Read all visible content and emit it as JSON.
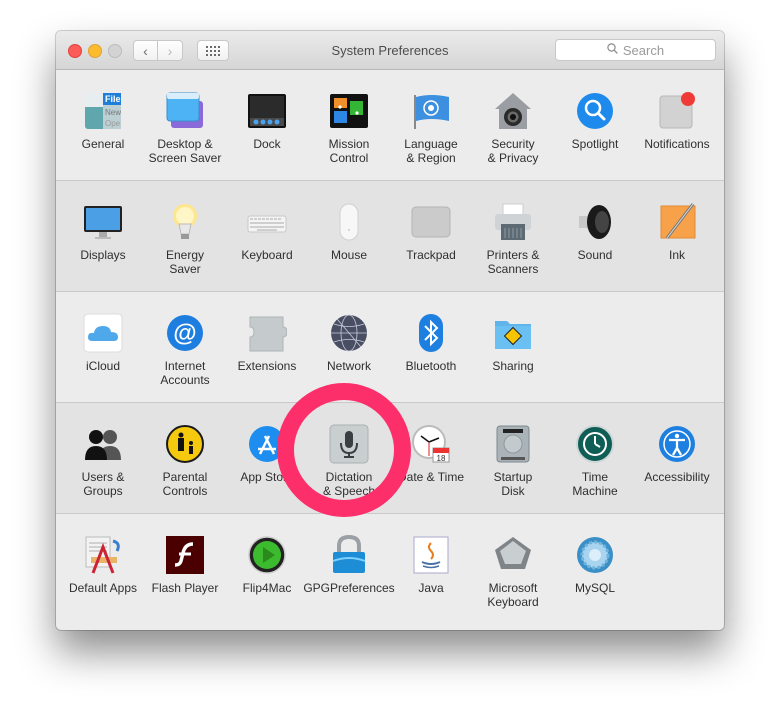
{
  "window": {
    "title": "System Preferences",
    "search_placeholder": "Search",
    "traffic_lights": {
      "close": "#fc5b57",
      "minimize": "#fdbb2e",
      "zoom": "#d3d3d3"
    },
    "nav": {
      "back_icon": "chevron-left-icon",
      "forward_icon": "chevron-right-icon",
      "show_all_icon": "grid-icon"
    }
  },
  "sections": [
    {
      "panes": [
        {
          "id": "general",
          "label": "General",
          "icon": "general-icon"
        },
        {
          "id": "desktop",
          "label": "Desktop &\nScreen Saver",
          "icon": "desktop-icon"
        },
        {
          "id": "dock",
          "label": "Dock",
          "icon": "dock-icon"
        },
        {
          "id": "mission",
          "label": "Mission\nControl",
          "icon": "mission-control-icon"
        },
        {
          "id": "language",
          "label": "Language\n& Region",
          "icon": "flag-icon"
        },
        {
          "id": "security",
          "label": "Security\n& Privacy",
          "icon": "security-icon"
        },
        {
          "id": "spotlight",
          "label": "Spotlight",
          "icon": "spotlight-icon"
        },
        {
          "id": "notifications",
          "label": "Notifications",
          "icon": "notifications-icon"
        }
      ]
    },
    {
      "panes": [
        {
          "id": "displays",
          "label": "Displays",
          "icon": "display-icon"
        },
        {
          "id": "energy",
          "label": "Energy\nSaver",
          "icon": "bulb-icon"
        },
        {
          "id": "keyboard",
          "label": "Keyboard",
          "icon": "keyboard-icon"
        },
        {
          "id": "mouse",
          "label": "Mouse",
          "icon": "mouse-icon"
        },
        {
          "id": "trackpad",
          "label": "Trackpad",
          "icon": "trackpad-icon"
        },
        {
          "id": "printers",
          "label": "Printers &\nScanners",
          "icon": "printer-icon"
        },
        {
          "id": "sound",
          "label": "Sound",
          "icon": "speaker-icon"
        },
        {
          "id": "ink",
          "label": "Ink",
          "icon": "ink-icon"
        }
      ]
    },
    {
      "panes": [
        {
          "id": "icloud",
          "label": "iCloud",
          "icon": "cloud-icon"
        },
        {
          "id": "internet",
          "label": "Internet\nAccounts",
          "icon": "at-sign-icon"
        },
        {
          "id": "extensions",
          "label": "Extensions",
          "icon": "puzzle-icon"
        },
        {
          "id": "network",
          "label": "Network",
          "icon": "globe-icon"
        },
        {
          "id": "bluetooth",
          "label": "Bluetooth",
          "icon": "bluetooth-icon"
        },
        {
          "id": "sharing",
          "label": "Sharing",
          "icon": "sharing-folder-icon"
        }
      ]
    },
    {
      "panes": [
        {
          "id": "users",
          "label": "Users &\nGroups",
          "icon": "users-icon"
        },
        {
          "id": "parental",
          "label": "Parental\nControls",
          "icon": "parental-icon"
        },
        {
          "id": "appstore",
          "label": "App Store",
          "icon": "app-store-icon"
        },
        {
          "id": "dictation",
          "label": "Dictation\n& Speech",
          "icon": "microphone-icon"
        },
        {
          "id": "datetime",
          "label": "Date & Time",
          "icon": "clock-calendar-icon"
        },
        {
          "id": "startup",
          "label": "Startup\nDisk",
          "icon": "hard-disk-icon"
        },
        {
          "id": "timemachine",
          "label": "Time\nMachine",
          "icon": "time-machine-icon"
        },
        {
          "id": "accessibility",
          "label": "Accessibility",
          "icon": "accessibility-icon"
        }
      ]
    },
    {
      "panes": [
        {
          "id": "defaultapps",
          "label": "Default Apps",
          "icon": "default-apps-icon"
        },
        {
          "id": "flash",
          "label": "Flash Player",
          "icon": "flash-icon"
        },
        {
          "id": "flip4mac",
          "label": "Flip4Mac",
          "icon": "play-icon"
        },
        {
          "id": "gpg",
          "label": "GPGPreferences",
          "icon": "padlock-icon"
        },
        {
          "id": "java",
          "label": "Java",
          "icon": "java-icon"
        },
        {
          "id": "mskeyboard",
          "label": "Microsoft\nKeyboard",
          "icon": "key-icon"
        },
        {
          "id": "mysql",
          "label": "MySQL",
          "icon": "mysql-gear-icon"
        }
      ]
    }
  ],
  "annotation": {
    "target": "Dictation & Speech",
    "shape": "circle",
    "color": "#fc2f6a"
  }
}
